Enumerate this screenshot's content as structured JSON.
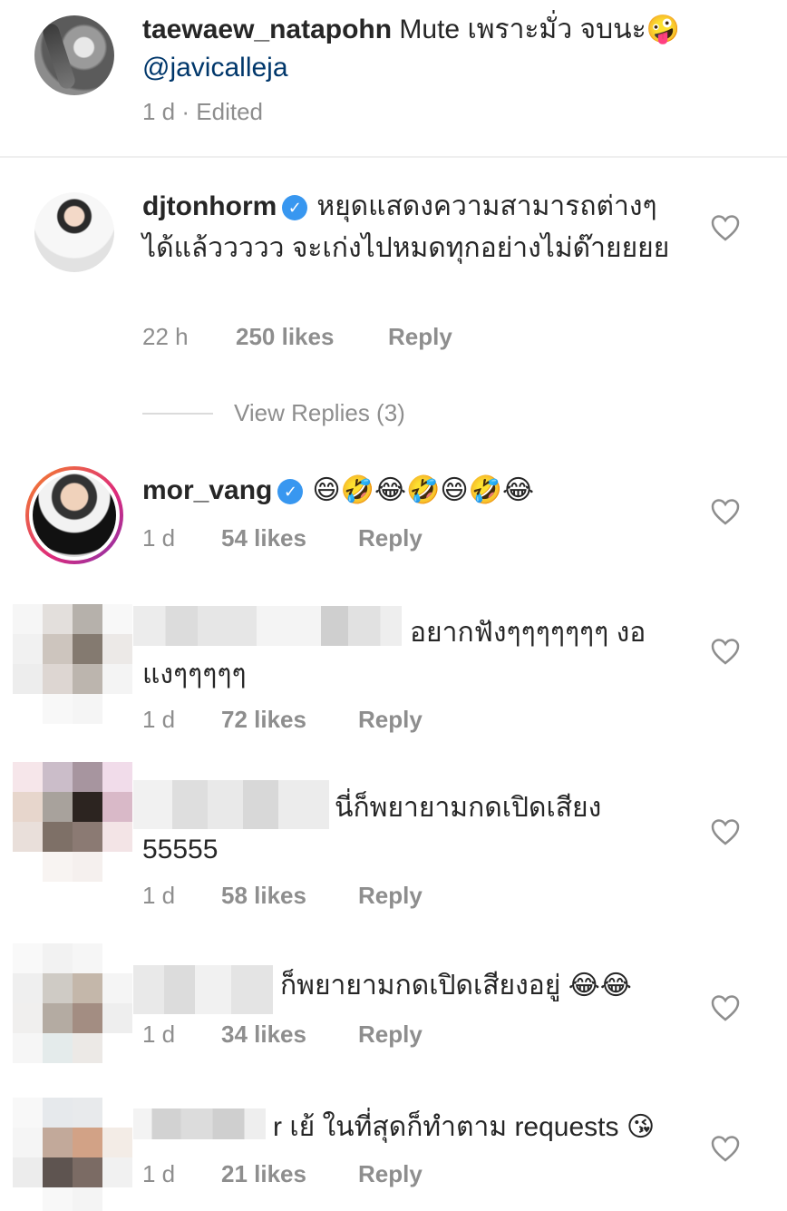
{
  "caption": {
    "username": "taewaew_natapohn",
    "text": " Mute เพราะมั่ว จบนะ🤪",
    "mention": "@javicalleja",
    "time": "1 d",
    "edited": " · Edited"
  },
  "comments": [
    {
      "username": "djtonhorm",
      "verified": true,
      "text": "หยุดแสดงความสามารถต่างๆได้แล้ววววว จะเก่งไปหมดทุกอย่างไม่ด๊ายยยย",
      "time": "22 h",
      "likes": "250 likes",
      "reply": "Reply"
    },
    {
      "username": "mor_vang",
      "verified": true,
      "text": "😄🤣😂🤣😄🤣😂",
      "time": "1 d",
      "likes": "54 likes",
      "reply": "Reply"
    },
    {
      "text": "อยากฟังๆๆๆๆๆๆๆ งอแงๆๆๆๆๆ",
      "time": "1 d",
      "likes": "72 likes",
      "reply": "Reply"
    },
    {
      "text": "นี่ก็พยายามกดเปิดเสียง 55555",
      "time": "1 d",
      "likes": "58 likes",
      "reply": "Reply"
    },
    {
      "text": "ก็พยายามกดเปิดเสียงอยู่ 😂😂",
      "time": "1 d",
      "likes": "34 likes",
      "reply": "Reply"
    },
    {
      "text": "r เย้ ในที่สุดก็ทำตาม requests 😘",
      "time": "1 d",
      "likes": "21 likes",
      "reply": "Reply"
    }
  ],
  "view_replies": "View Replies (3)",
  "icons": {
    "heart": "heart-outline-icon",
    "verified": "verified-badge-icon"
  },
  "colors": {
    "text": "#262626",
    "muted": "#8e8e8e",
    "link": "#00376b",
    "verified": "#3897f0"
  }
}
